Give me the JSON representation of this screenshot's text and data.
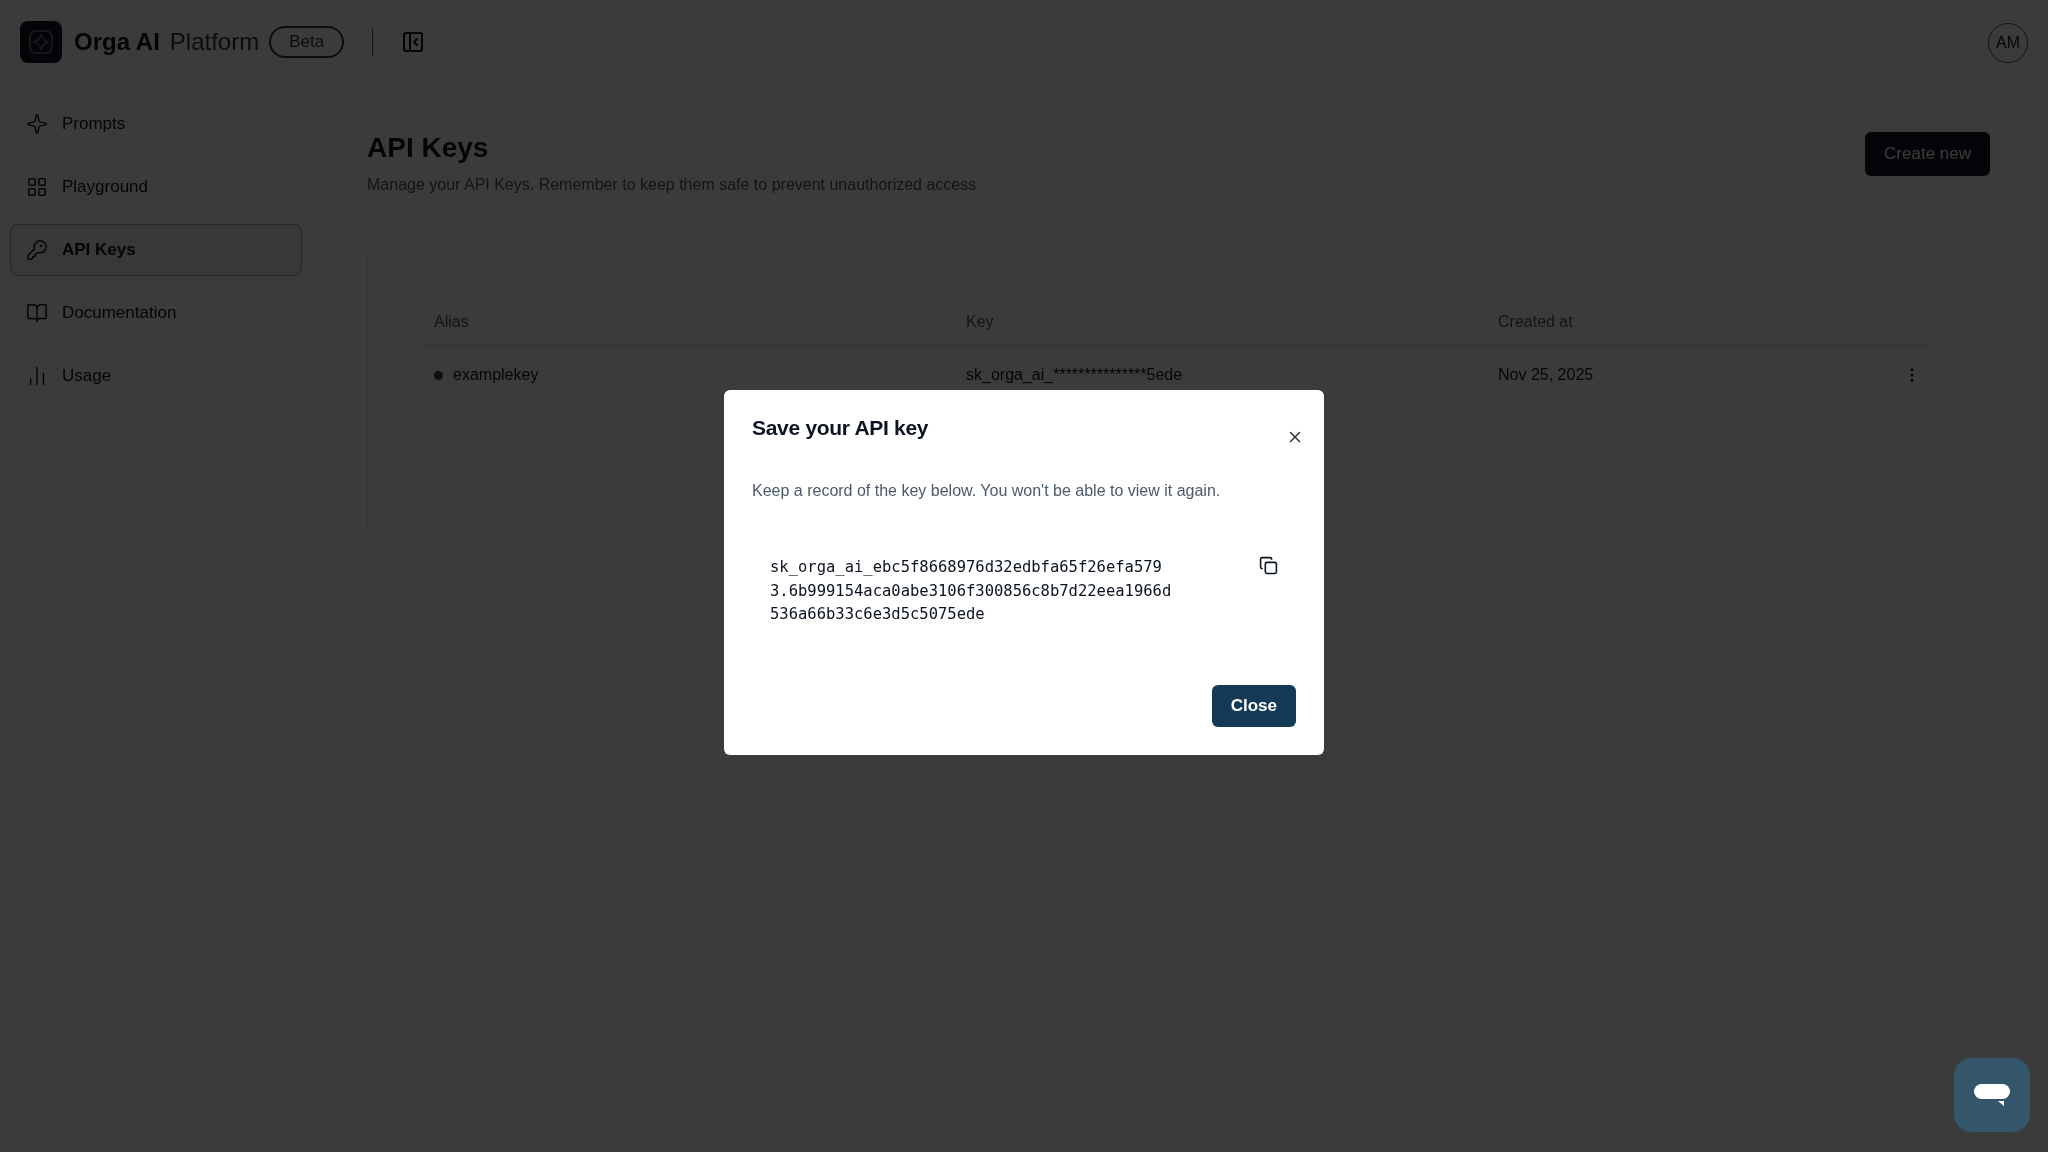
{
  "header": {
    "brand": "Orga AI",
    "product": "Platform",
    "badge": "Beta",
    "avatar": "AM"
  },
  "sidebar": {
    "items": [
      {
        "label": "Prompts",
        "selected": false
      },
      {
        "label": "Playground",
        "selected": false
      },
      {
        "label": "API Keys",
        "selected": true
      },
      {
        "label": "Documentation",
        "selected": false
      },
      {
        "label": "Usage",
        "selected": false
      }
    ]
  },
  "page": {
    "title": "API Keys",
    "subtitle": "Manage your API Keys. Remember to keep them safe to prevent unauthorized access",
    "create_button": "Create new"
  },
  "table": {
    "columns": [
      "Alias",
      "Key",
      "Created at"
    ],
    "rows": [
      {
        "alias": "examplekey",
        "key": "sk_orga_ai_***************5ede",
        "created": "Nov 25, 2025"
      }
    ]
  },
  "dialog": {
    "title": "Save your API key",
    "description": "Keep a record of the key below. You won't be able to view it again.",
    "key_lines": [
      "sk_orga_ai_ebc5f8668976d32edbfa65f26efa579",
      "3.6b999154aca0abe3106f300856c8b7d22eea1966d",
      "536a66b33c6e3d5c5075ede"
    ],
    "close_button": "Close"
  }
}
